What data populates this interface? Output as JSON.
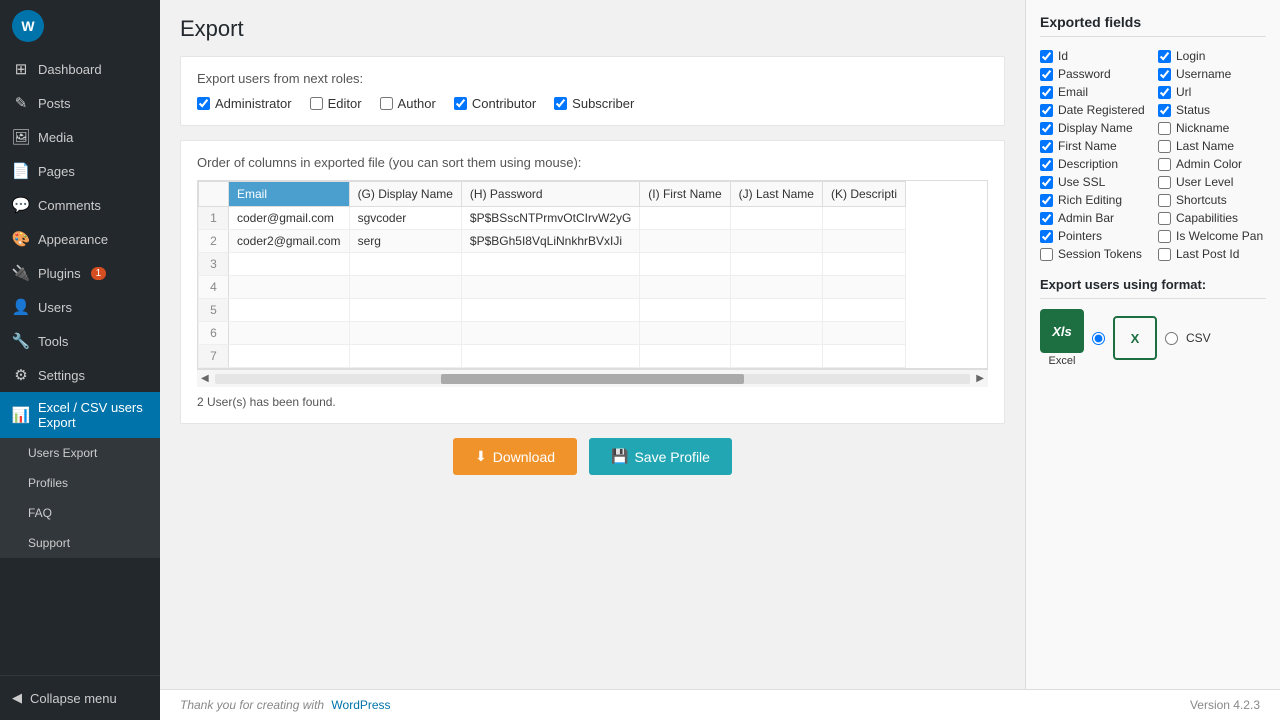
{
  "topbar": {},
  "sidebar": {
    "items": [
      {
        "id": "dashboard",
        "label": "Dashboard",
        "icon": "⊞",
        "active": false
      },
      {
        "id": "posts",
        "label": "Posts",
        "icon": "✎",
        "active": false
      },
      {
        "id": "media",
        "label": "Media",
        "icon": "🖼",
        "active": false
      },
      {
        "id": "pages",
        "label": "Pages",
        "icon": "📄",
        "active": false
      },
      {
        "id": "comments",
        "label": "Comments",
        "icon": "💬",
        "active": false
      },
      {
        "id": "appearance",
        "label": "Appearance",
        "icon": "🎨",
        "active": false
      },
      {
        "id": "plugins",
        "label": "Plugins",
        "icon": "🔌",
        "badge": "1",
        "active": false
      },
      {
        "id": "users",
        "label": "Users",
        "icon": "👤",
        "active": false
      },
      {
        "id": "tools",
        "label": "Tools",
        "icon": "🔧",
        "active": false
      },
      {
        "id": "settings",
        "label": "Settings",
        "icon": "⚙",
        "active": false
      },
      {
        "id": "excel-csv",
        "label": "Excel / CSV users Export",
        "icon": "📊",
        "active": true
      }
    ],
    "submenu": [
      {
        "id": "users-export",
        "label": "Users Export",
        "active": false
      },
      {
        "id": "profiles",
        "label": "Profiles",
        "active": false
      },
      {
        "id": "faq",
        "label": "FAQ",
        "active": false
      },
      {
        "id": "support",
        "label": "Support",
        "active": false
      }
    ],
    "collapse_label": "Collapse menu"
  },
  "page": {
    "title": "Export",
    "roles_section": {
      "label": "Export users from next roles:",
      "roles": [
        {
          "id": "administrator",
          "label": "Administrator",
          "checked": true
        },
        {
          "id": "editor",
          "label": "Editor",
          "checked": false
        },
        {
          "id": "author",
          "label": "Author",
          "checked": false
        },
        {
          "id": "contributor",
          "label": "Contributor",
          "checked": true
        },
        {
          "id": "subscriber",
          "label": "Subscriber",
          "checked": true
        }
      ]
    },
    "columns_section": {
      "label": "Order of columns in exported file (you can sort them using mouse):",
      "headers": [
        {
          "id": "email",
          "label": "Email",
          "selected": true
        },
        {
          "id": "display_name",
          "label": "(G) Display Name",
          "selected": false
        },
        {
          "id": "password",
          "label": "(H) Password",
          "selected": false
        },
        {
          "id": "first_name",
          "label": "(I) First Name",
          "selected": false
        },
        {
          "id": "last_name",
          "label": "(J) Last Name",
          "selected": false
        },
        {
          "id": "description",
          "label": "(K) Descripti",
          "selected": false
        }
      ],
      "rows": [
        {
          "num": 1,
          "email": "coder@gmail.com",
          "display_name": "sgvcoder",
          "password": "$P$BSscNTPrmvOtCIrvW2yG",
          "first_name": "",
          "last_name": "",
          "description": ""
        },
        {
          "num": 2,
          "email": "coder2@gmail.com",
          "display_name": "serg",
          "password": "$P$BGh5I8VqLiNnkhrBVxIJi",
          "first_name": "",
          "last_name": "",
          "description": ""
        },
        {
          "num": 3,
          "email": "",
          "display_name": "",
          "password": "",
          "first_name": "",
          "last_name": "",
          "description": ""
        },
        {
          "num": 4,
          "email": "",
          "display_name": "",
          "password": "",
          "first_name": "",
          "last_name": "",
          "description": ""
        },
        {
          "num": 5,
          "email": "",
          "display_name": "",
          "password": "",
          "first_name": "",
          "last_name": "",
          "description": ""
        },
        {
          "num": 6,
          "email": "",
          "display_name": "",
          "password": "",
          "first_name": "",
          "last_name": "",
          "description": ""
        },
        {
          "num": 7,
          "email": "",
          "display_name": "",
          "password": "",
          "first_name": "",
          "last_name": "",
          "description": ""
        }
      ],
      "found_text": "2 User(s) has been found."
    },
    "buttons": {
      "download": "⬇ Download",
      "save_profile": "💾 Save Profile"
    }
  },
  "right_panel": {
    "exported_fields_title": "Exported fields",
    "fields_left": [
      {
        "label": "Id",
        "checked": true
      },
      {
        "label": "Password",
        "checked": true
      },
      {
        "label": "Email",
        "checked": true
      },
      {
        "label": "Date Registered",
        "checked": true
      },
      {
        "label": "Display Name",
        "checked": true
      },
      {
        "label": "First Name",
        "checked": true
      },
      {
        "label": "Description",
        "checked": true
      },
      {
        "label": "Use SSL",
        "checked": true
      },
      {
        "label": "Rich Editing",
        "checked": true
      },
      {
        "label": "Admin Bar",
        "checked": true
      },
      {
        "label": "Pointers",
        "checked": true
      },
      {
        "label": "Session Tokens",
        "checked": false
      }
    ],
    "fields_right": [
      {
        "label": "Login",
        "checked": true
      },
      {
        "label": "Username",
        "checked": true
      },
      {
        "label": "Url",
        "checked": true
      },
      {
        "label": "Status",
        "checked": true
      },
      {
        "label": "Nickname",
        "checked": false
      },
      {
        "label": "Last Name",
        "checked": false
      },
      {
        "label": "Admin Color",
        "checked": false
      },
      {
        "label": "User Level",
        "checked": false
      },
      {
        "label": "Shortcuts",
        "checked": false
      },
      {
        "label": "Capabilities",
        "checked": false
      },
      {
        "label": "Is Welcome Pan",
        "checked": false
      },
      {
        "label": "Last Post Id",
        "checked": false
      }
    ],
    "format_title": "Export users using format:",
    "formats": [
      {
        "id": "excel",
        "label": "Excel",
        "selected": true
      },
      {
        "id": "csv",
        "label": "CSV",
        "selected": false
      }
    ]
  },
  "footer": {
    "thank_you_text": "Thank you for creating with",
    "wp_link_text": "WordPress",
    "version_text": "Version 4.2.3"
  }
}
